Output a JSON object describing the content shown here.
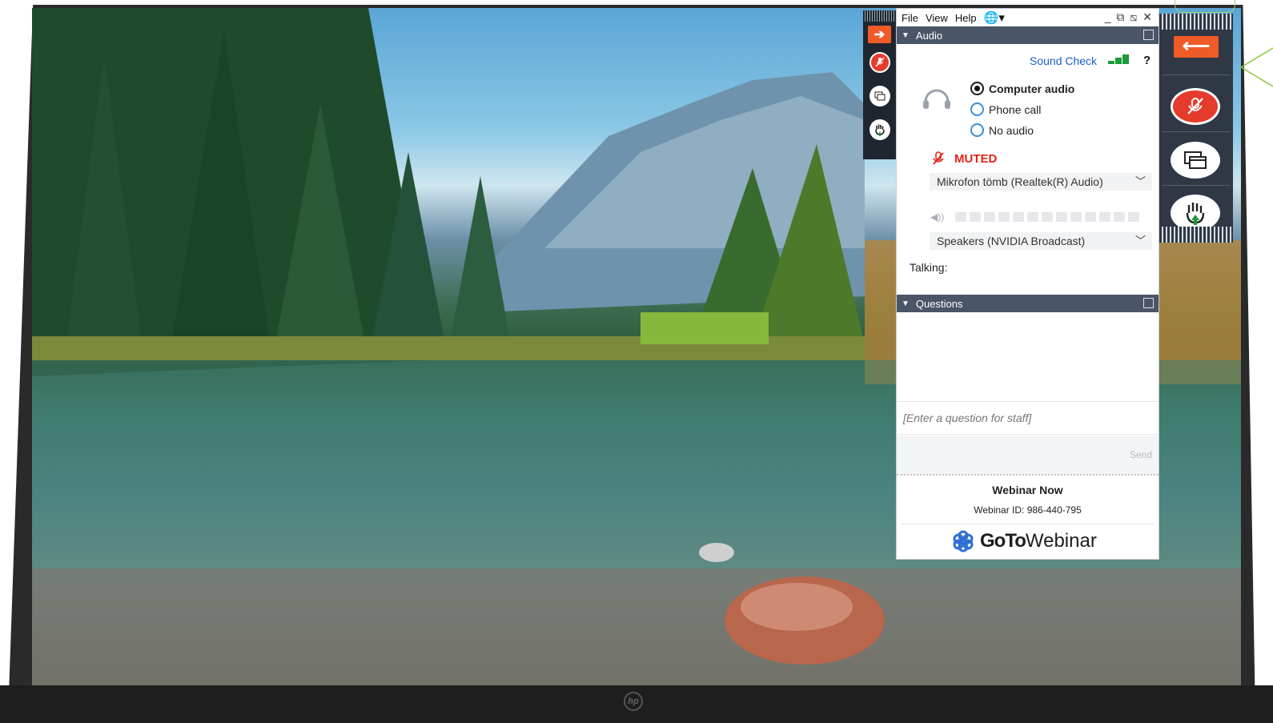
{
  "menu": {
    "file": "File",
    "view": "View",
    "help": "Help"
  },
  "audio": {
    "header": "Audio",
    "sound_check": "Sound Check",
    "help": "?",
    "options": {
      "computer": "Computer audio",
      "phone": "Phone call",
      "none": "No audio"
    },
    "selected_option": "Computer audio",
    "muted_label": "MUTED",
    "microphone": "Mikrofon tömb (Realtek(R) Audio)",
    "speaker": "Speakers (NVIDIA Broadcast)",
    "talking_label": "Talking:"
  },
  "questions": {
    "header": "Questions",
    "placeholder": "[Enter a question for staff]",
    "send_label": "Send"
  },
  "webinar": {
    "title": "Webinar Now",
    "id_text": "Webinar ID: 986-440-795",
    "brand_goto": "GoTo",
    "brand_webinar": "Webinar"
  },
  "colors": {
    "accent_orange": "#f05a28",
    "mute_red": "#e53b2c",
    "link_blue": "#1a5fc8",
    "signal_green": "#1d9a3a",
    "header_slate": "#4a5567"
  }
}
